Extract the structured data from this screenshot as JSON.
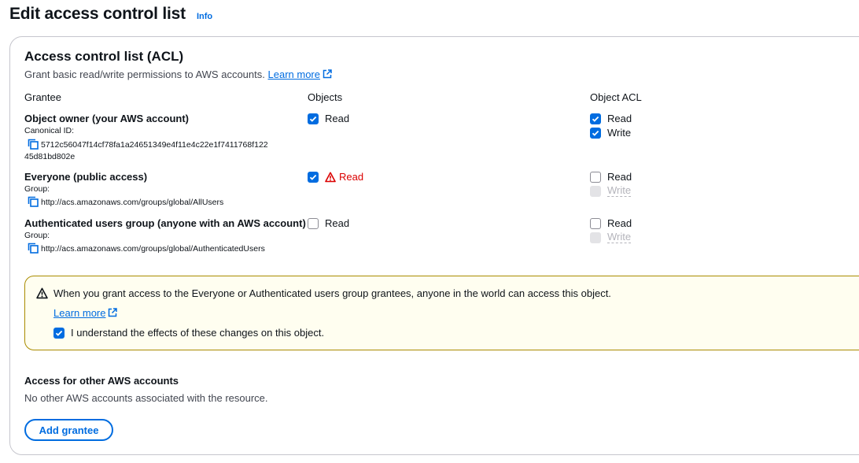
{
  "page": {
    "title": "Edit access control list",
    "info_label": "Info"
  },
  "acl": {
    "title": "Access control list (ACL)",
    "description": "Grant basic read/write permissions to AWS accounts.",
    "learn_more": "Learn more",
    "columns": [
      "Grantee",
      "Objects",
      "Object ACL"
    ],
    "grantees": [
      {
        "name": "Object owner (your AWS account)",
        "id_label": "Canonical ID:",
        "id_line1": "5712c56047f14cf78fa1a24651349e4f11e4c22e1f7411768f122",
        "id_line2": "45d81bd802e",
        "objects_read": {
          "label": "Read",
          "checked": true
        },
        "acl_read": {
          "label": "Read",
          "checked": true
        },
        "acl_write": {
          "label": "Write",
          "checked": true
        }
      },
      {
        "name": "Everyone (public access)",
        "id_label": "Group:",
        "id_line1": "http://acs.amazonaws.com/groups/global/AllUsers",
        "objects_read": {
          "label": "Read",
          "checked": true,
          "warning": true
        },
        "acl_read": {
          "label": "Read",
          "checked": false
        },
        "acl_write": {
          "label": "Write",
          "checked": false,
          "disabled": true
        }
      },
      {
        "name": "Authenticated users group (anyone with an AWS account)",
        "id_label": "Group:",
        "id_line1": "http://acs.amazonaws.com/groups/global/AuthenticatedUsers",
        "objects_read": {
          "label": "Read",
          "checked": false
        },
        "acl_read": {
          "label": "Read",
          "checked": false
        },
        "acl_write": {
          "label": "Write",
          "checked": false,
          "disabled": true
        }
      }
    ]
  },
  "alert": {
    "message": "When you grant access to the Everyone or Authenticated users group grantees, anyone in the world can access this object.",
    "learn_more": "Learn more",
    "ack_label": "I understand the effects of these changes on this object.",
    "ack_checked": true
  },
  "other_accounts": {
    "title": "Access for other AWS accounts",
    "description": "No other AWS accounts associated with the resource.",
    "add_button": "Add grantee"
  },
  "colors": {
    "link": "#006ce0",
    "checkbox": "#006ce0",
    "warning_red": "#db0000",
    "alert_bg": "#fffef0",
    "alert_border": "#a98b00"
  },
  "icons": {
    "external": "external-link-icon",
    "copy": "copy-icon",
    "warning": "warning-icon",
    "check": "checkmark-icon"
  }
}
